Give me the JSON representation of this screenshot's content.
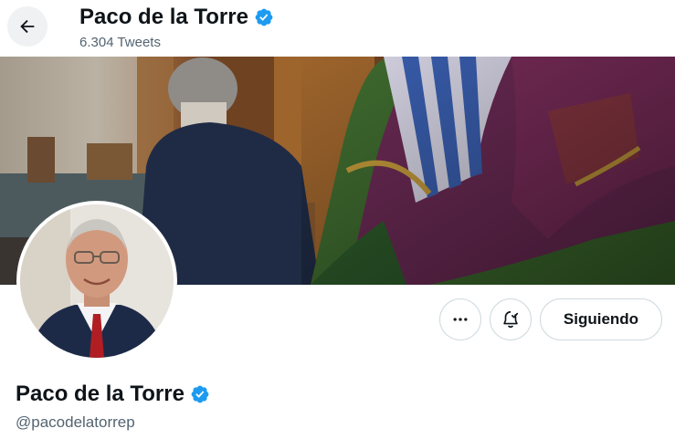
{
  "header": {
    "back_label": "Back",
    "title": "Paco de la Torre",
    "tweet_count": "6.304 Tweets"
  },
  "banner": {
    "description": "header photo"
  },
  "avatar": {
    "alt": "profile photo"
  },
  "actions": {
    "more_label": "More",
    "notifications_label": "Notifications",
    "follow_label": "Siguiendo"
  },
  "profile": {
    "name": "Paco de la Torre",
    "handle": "@pacodelatorrep"
  },
  "colors": {
    "verified": "#1d9bf0",
    "secondary_text": "#536471",
    "border": "#cfd9de"
  }
}
